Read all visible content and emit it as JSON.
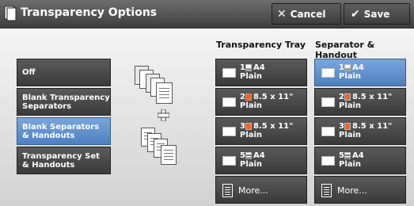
{
  "header": {
    "title": "Transparency Options",
    "cancel_label": "Cancel",
    "save_label": "Save"
  },
  "columns": {
    "tray_header": "Transparency Tray",
    "separator_header": "Separator & Handout"
  },
  "options": [
    {
      "label": "Off",
      "selected": false
    },
    {
      "label": "Blank Transparency\nSeparators",
      "selected": false
    },
    {
      "label": "Blank Separators\n& Handouts",
      "selected": true
    },
    {
      "label": "Transparency Set\n& Handouts",
      "selected": false
    }
  ],
  "transparency_tray": [
    {
      "tray": "1",
      "size": "A4",
      "type": "Plain",
      "icon": "white-paper-icon",
      "selected": false
    },
    {
      "tray": "2",
      "size": "8.5 x 11\"",
      "type": "Plain",
      "icon": "orange-paper-icon",
      "selected": false
    },
    {
      "tray": "3",
      "size": "8.5 x 11\"",
      "type": "Plain",
      "icon": "orange-paper-icon",
      "selected": false
    },
    {
      "tray": "5",
      "size": "A4",
      "type": "Plain",
      "icon": "bypass-tray-icon",
      "selected": false
    }
  ],
  "separator_tray": [
    {
      "tray": "1",
      "size": "A4",
      "type": "Plain",
      "icon": "white-paper-icon",
      "selected": true
    },
    {
      "tray": "2",
      "size": "8.5 x 11\"",
      "type": "Plain",
      "icon": "orange-paper-icon",
      "selected": false
    },
    {
      "tray": "3",
      "size": "8.5 x 11\"",
      "type": "Plain",
      "icon": "orange-paper-icon",
      "selected": false
    },
    {
      "tray": "5",
      "size": "A4",
      "type": "Plain",
      "icon": "bypass-tray-icon",
      "selected": false
    }
  ],
  "more_label": "More...",
  "colors": {
    "selected_blue": "#5d8fd0",
    "button_dark": "#4a4a4a",
    "orange_paper": "#e8672a"
  }
}
